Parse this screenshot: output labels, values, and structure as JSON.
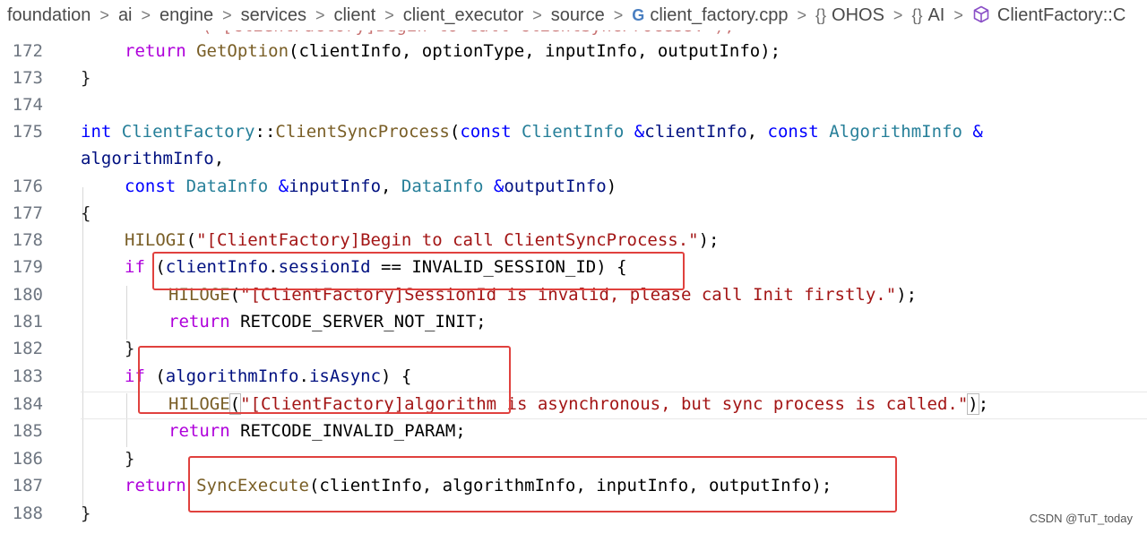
{
  "breadcrumb": {
    "items": [
      "foundation",
      "ai",
      "engine",
      "services",
      "client",
      "client_executor",
      "source"
    ],
    "file": "client_factory.cpp",
    "namespaces": [
      "OHOS",
      "AI"
    ],
    "symbol": "ClientFactory::C",
    "separator": ">",
    "namespace_icon": "{}",
    "file_icon": "G"
  },
  "editor": {
    "line_numbers": [
      "172",
      "173",
      "174",
      "175",
      "",
      "176",
      "177",
      "178",
      "179",
      "180",
      "181",
      "182",
      "183",
      "184",
      "185",
      "186",
      "187",
      "188"
    ],
    "top_partial_line": "(\"[ClientFactory]Begin to call ClientSyncProcess.\");",
    "code": {
      "l172": {
        "kw": "return",
        "fn": "GetOption",
        "rest": "(clientInfo, optionType, inputInfo, outputInfo);"
      },
      "l173": "}",
      "l175": {
        "kw": "int",
        "cls": "ClientFactory",
        "sep": "::",
        "fn": "ClientSyncProcess",
        "open": "(",
        "const1": "const",
        "type1": "ClientInfo",
        "amp1": " &",
        "param1": "clientInfo",
        "comma1": ", ",
        "const2": "const",
        "type2": "AlgorithmInfo",
        "amp2": " &"
      },
      "l175b": {
        "param": "algorithmInfo",
        "comma": ","
      },
      "l176": {
        "const": "const",
        "type1": "DataInfo",
        "amp1": " &",
        "param1": "inputInfo",
        "comma": ", ",
        "type2": "DataInfo",
        "amp2": " &",
        "param2": "outputInfo",
        "close": ")"
      },
      "l177": "{",
      "l178": {
        "fn": "HILOGI",
        "open": "(",
        "str": "\"[ClientFactory]Begin to call ClientSyncProcess.\"",
        "close": ");"
      },
      "l179": {
        "kw": "if",
        "open": " (",
        "obj": "clientInfo",
        "dot": ".",
        "field": "sessionId",
        "op": " == ",
        "const": "INVALID_SESSION_ID",
        "close": ") {"
      },
      "l180": {
        "fn": "HILOGE",
        "open": "(",
        "str": "\"[ClientFactory]SessionId is invalid, please call Init firstly.\"",
        "close": ");"
      },
      "l181": {
        "kw": "return",
        "val": " RETCODE_SERVER_NOT_INIT;"
      },
      "l182": "}",
      "l183": {
        "kw": "if",
        "open": " (",
        "obj": "algorithmInfo",
        "dot": ".",
        "field": "isAsync",
        "close": ") {"
      },
      "l184": {
        "fn": "HILOGE",
        "open": "(",
        "str": "\"[ClientFactory]algorithm is asynchronous, but sync process is called.\"",
        "close_paren": ")",
        "semi": ";"
      },
      "l185": {
        "kw": "return",
        "val": " RETCODE_INVALID_PARAM;"
      },
      "l186": "}",
      "l187": {
        "kw": "return",
        "fn": "SyncExecute",
        "rest": "(clientInfo, algorithmInfo, inputInfo, outputInfo);"
      },
      "l188": "}"
    }
  },
  "watermark": "CSDN @TuT_today",
  "colors": {
    "keyword": "#0000ff",
    "control_keyword": "#af00db",
    "type": "#267f99",
    "function": "#795e26",
    "parameter": "#001080",
    "string": "#a31515",
    "annotation_box": "#e0413e"
  }
}
